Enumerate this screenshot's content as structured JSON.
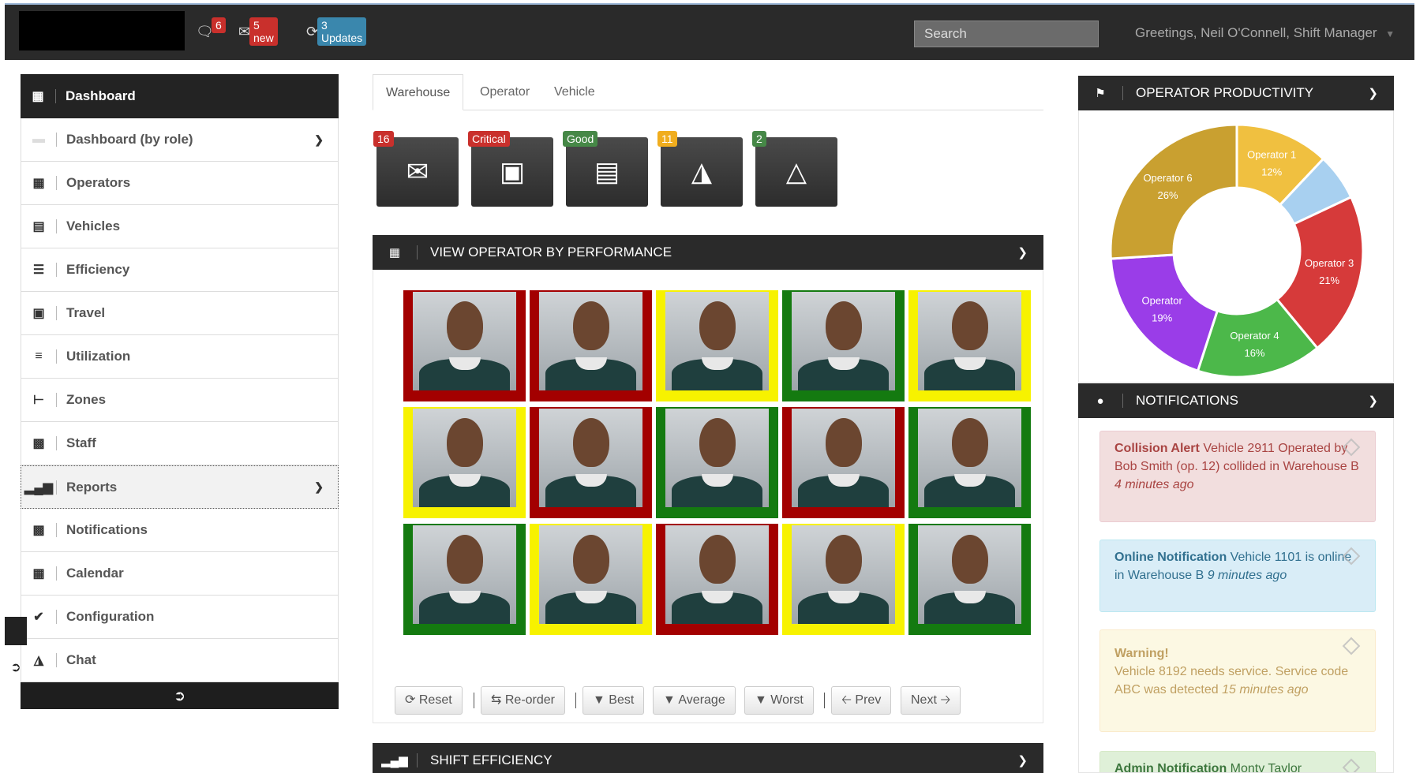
{
  "topbar": {
    "comments_count": "6",
    "messages_label": "5 new",
    "updates_label": "3 Updates",
    "search_placeholder": "Search",
    "greeting": "Greetings, Neil O'Connell, Shift Manager"
  },
  "sidebar": {
    "items": [
      {
        "label": "Dashboard",
        "icon": "grid-icon"
      },
      {
        "label": "Dashboard (by role)",
        "icon": "blank-icon"
      },
      {
        "label": "Operators",
        "icon": "th-icon"
      },
      {
        "label": "Vehicles",
        "icon": "list-alt-icon"
      },
      {
        "label": "Efficiency",
        "icon": "stack-icon"
      },
      {
        "label": "Travel",
        "icon": "picture-icon"
      },
      {
        "label": "Utilization",
        "icon": "align-center-icon"
      },
      {
        "label": "Zones",
        "icon": "indent-icon"
      },
      {
        "label": "Staff",
        "icon": "gift-icon"
      },
      {
        "label": "Reports",
        "icon": "signal-icon"
      },
      {
        "label": "Notifications",
        "icon": "comment-icon"
      },
      {
        "label": "Calendar",
        "icon": "calendar-icon"
      },
      {
        "label": "Configuration",
        "icon": "check-icon"
      },
      {
        "label": "Chat",
        "icon": "bullhorn-icon"
      }
    ]
  },
  "tabs": [
    {
      "label": "Warehouse"
    },
    {
      "label": "Operator"
    },
    {
      "label": "Vehicle"
    }
  ],
  "tiles": [
    {
      "badge": "16",
      "icon": "envelope-icon"
    },
    {
      "badge": "Critical",
      "icon": "picture-icon"
    },
    {
      "badge": "Good",
      "icon": "newspaper-icon"
    },
    {
      "badge": "11",
      "icon": "bullhorn-icon"
    },
    {
      "badge": "2",
      "icon": "flask-icon"
    }
  ],
  "performance": {
    "title": "VIEW OPERATOR BY PERFORMANCE",
    "grid_colors": [
      [
        "red",
        "red",
        "yellow",
        "green",
        "yellow"
      ],
      [
        "yellow",
        "red",
        "green",
        "red",
        "green"
      ],
      [
        "green",
        "yellow",
        "red",
        "yellow",
        "green"
      ]
    ],
    "buttons": {
      "reset": "Reset",
      "reorder": "Re-order",
      "best": "Best",
      "average": "Average",
      "worst": "Worst",
      "prev": "Prev",
      "next": "Next"
    }
  },
  "shift_efficiency": {
    "title": "SHIFT EFFICIENCY"
  },
  "productivity": {
    "title": "OPERATOR PRODUCTIVITY",
    "chart_data": {
      "type": "pie",
      "donut": true,
      "slices": [
        {
          "name": "Operator 1",
          "value": 12,
          "label": "12%",
          "color": "#f0c040"
        },
        {
          "name": "",
          "value": 6,
          "label": "",
          "color": "#a8d0f0"
        },
        {
          "name": "Operator 3",
          "value": 21,
          "label": "21%",
          "color": "#d63a3a"
        },
        {
          "name": "Operator 4",
          "value": 16,
          "label": "16%",
          "color": "#4cb84a"
        },
        {
          "name": "Operator",
          "value": 19,
          "label": "19%",
          "color": "#9a3de8"
        },
        {
          "name": "Operator 6",
          "value": 26,
          "label": "26%",
          "color": "#c9a030"
        }
      ]
    }
  },
  "notifications": {
    "title": "NOTIFICATIONS",
    "items": [
      {
        "title": "Collision Alert",
        "text": "Vehicle 2911 Operated by Bob Smith (op. 12) collided in Warehouse B",
        "time": "4 minutes ago"
      },
      {
        "title": "Online Notification",
        "text": "Vehicle 1101 is online in Warehouse B",
        "time": "9 minutes ago"
      },
      {
        "title": "Warning!",
        "text": "Vehicle 8192 needs service. Service code ABC was detected",
        "time": "15 minutes ago"
      },
      {
        "title": "Admin Notification",
        "text": "Monty Taylor",
        "time": ""
      }
    ]
  }
}
